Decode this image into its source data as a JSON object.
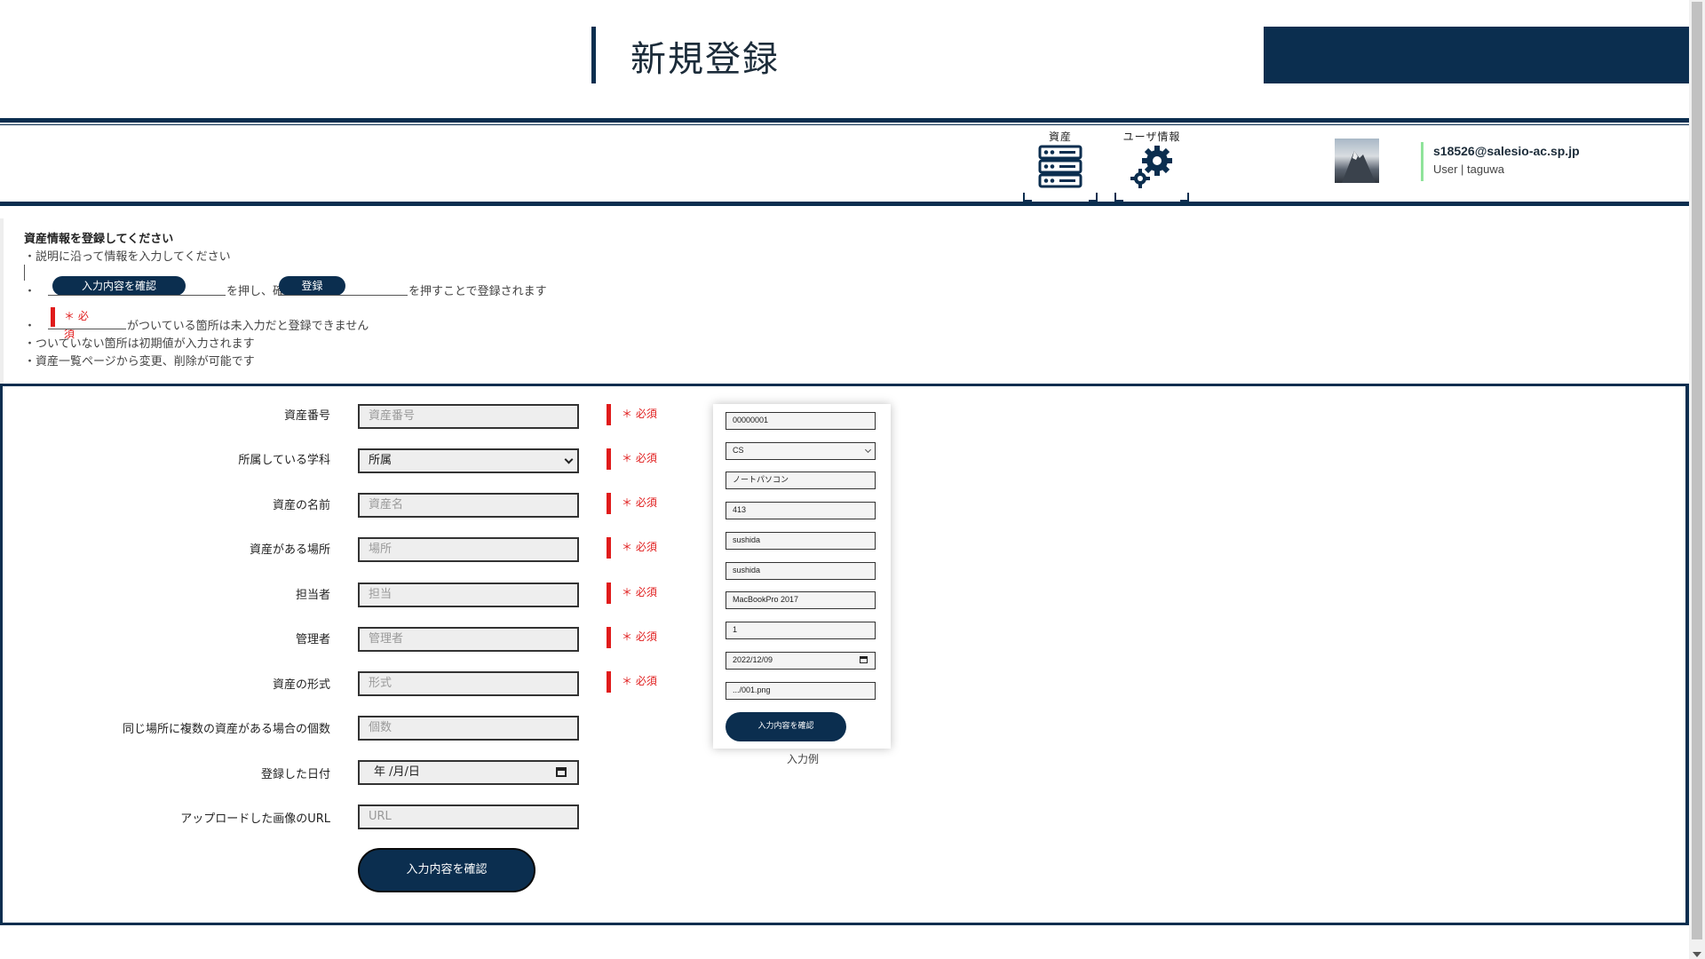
{
  "header": {
    "title": "新規登録"
  },
  "nav": {
    "assets_label": "資産",
    "user_info_label": "ユーザ情報"
  },
  "user": {
    "email": "s18526@salesio-ac.sp.jp",
    "role": "User | taguwa"
  },
  "instructions": {
    "heading": "資産情報を登録してください",
    "line1": "・説明に沿って情報を入力してください",
    "line2_bullet": "・",
    "line2_button1": "入力内容を確認",
    "line2_mid": "を押し、確",
    "line2_button2": "登録",
    "line2_end": "を押すことで登録されます",
    "line3_bullet": "・",
    "line3_required": "＊ 必須",
    "line3_end": "がついている箇所は未入力だと登録できません",
    "line4": "・ついていない箇所は初期値が入力されます",
    "line5": "・資産一覧ページから変更、削除が可能です"
  },
  "form": {
    "fields": [
      {
        "label": "資産番号",
        "placeholder": "資産番号",
        "required": true
      },
      {
        "label": "所属している学科",
        "value": "所属",
        "required": true
      },
      {
        "label": "資産の名前",
        "placeholder": "資産名",
        "required": true
      },
      {
        "label": "資産がある場所",
        "placeholder": "場所",
        "required": true
      },
      {
        "label": "担当者",
        "placeholder": "担当",
        "required": true
      },
      {
        "label": "管理者",
        "placeholder": "管理者",
        "required": true
      },
      {
        "label": "資産の形式",
        "placeholder": "形式",
        "required": true
      },
      {
        "label": "同じ場所に複数の資産がある場合の個数",
        "placeholder": "個数",
        "required": false
      },
      {
        "label": "登録した日付",
        "value": "年 /月/日",
        "required": false
      },
      {
        "label": "アップロードした画像のURL",
        "placeholder": "URL",
        "required": false
      }
    ],
    "required_text": "＊ 必須",
    "confirm_label": "入力内容を確認"
  },
  "example": {
    "values": [
      "00000001",
      "CS",
      "ノートパソコン",
      "413",
      "sushida",
      "sushida",
      "MacBookPro 2017",
      "1",
      "2022/12/09",
      ".../001.png"
    ],
    "button_label": "入力内容を確認",
    "caption": "入力例"
  },
  "colors": {
    "navy": "#0b2e4f",
    "required_red": "#e01b1b",
    "user_accent": "#8fe39a"
  }
}
